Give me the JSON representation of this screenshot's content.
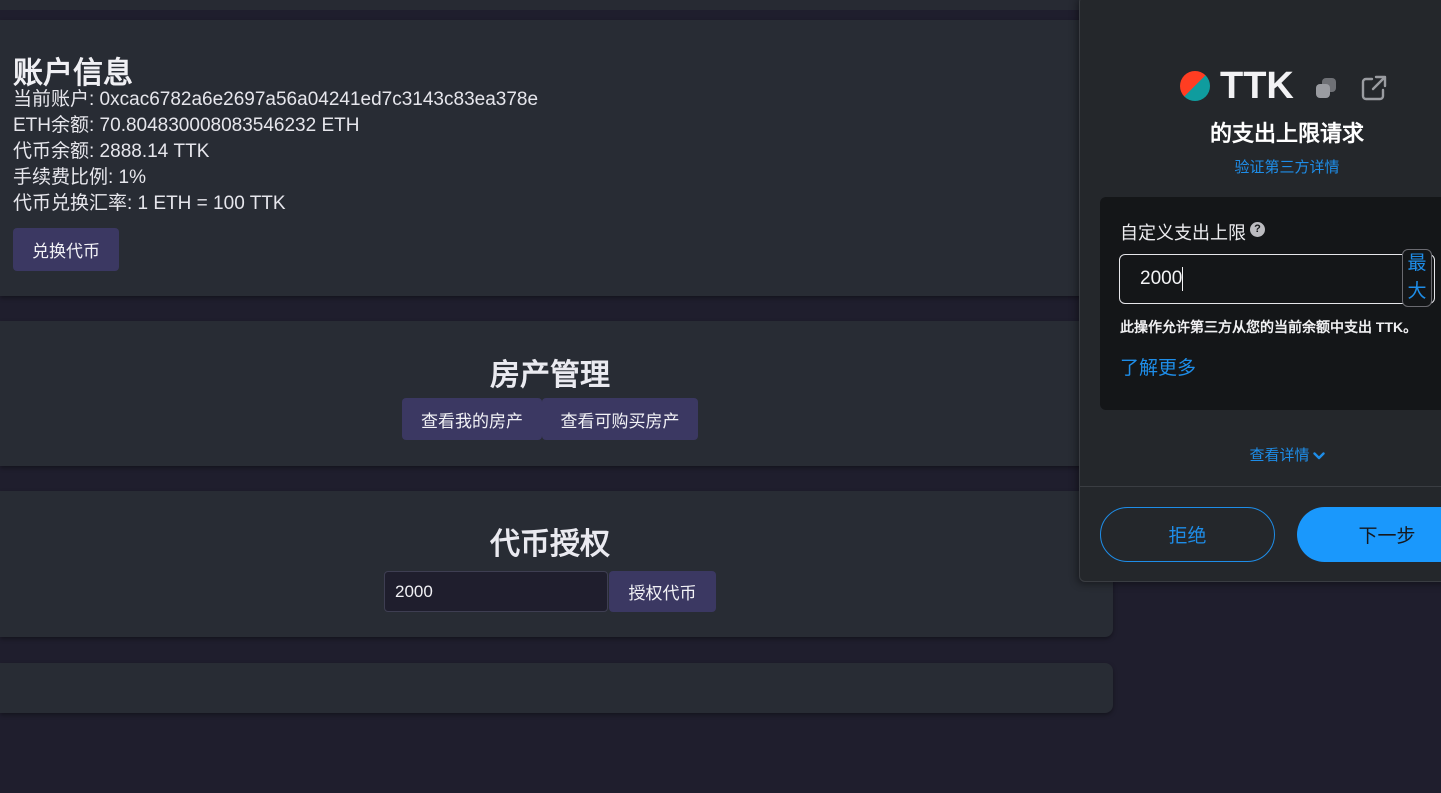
{
  "account": {
    "title": "账户信息",
    "current_account": "当前账户: 0xcac6782a6e2697a56a04241ed7c3143c83ea378e",
    "eth_balance": "ETH余额: 70.804830008083546232 ETH",
    "token_balance": "代币余额: 2888.14 TTK",
    "fee_ratio": "手续费比例: 1%",
    "exchange_rate": "代币兑换汇率: 1 ETH = 100 TTK",
    "exchange_button": "兑换代币"
  },
  "property": {
    "title": "房产管理",
    "my_property_button": "查看我的房产",
    "buy_property_button": "查看可购买房产"
  },
  "approve": {
    "title": "代币授权",
    "amount_value": "2000",
    "approve_button": "授权代币"
  },
  "wallet": {
    "token_symbol": "TTK",
    "title": "的支出上限请求",
    "verify_link": "验证第三方详情",
    "limit_label": "自定义支出上限",
    "help_icon": "?",
    "limit_value": "2000",
    "max_button": "最大",
    "description": "此操作允许第三方从您的当前余额中支出 TTK。",
    "learn_more": "了解更多",
    "details_link": "查看详情",
    "reject_button": "拒绝",
    "next_button": "下一步",
    "icons": [
      "token-logo-icon",
      "copy-icon",
      "external-link-icon",
      "help-icon",
      "chevron-down-icon"
    ],
    "colors": {
      "accent": "#1a98fc",
      "link": "#1e8de8",
      "popup_bg": "#24272b"
    }
  },
  "colors": {
    "page_bg": "#1f1e2d",
    "card_bg": "#282c34",
    "button_bg": "#3b3862"
  }
}
